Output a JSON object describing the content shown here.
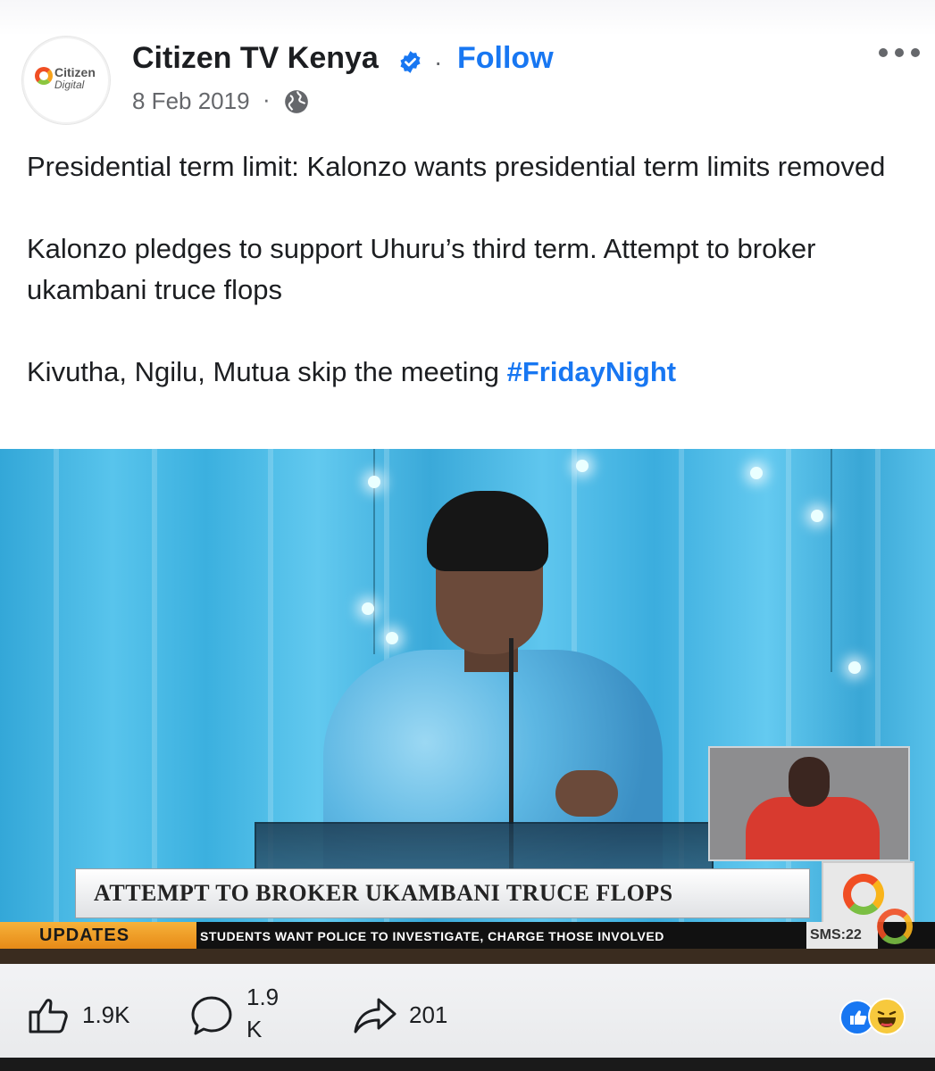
{
  "post": {
    "page_name": "Citizen TV Kenya",
    "follow_label": "Follow",
    "separator": "·",
    "date": "8 Feb 2019",
    "date_separator": "·",
    "avatar_text_line1": "Citizen",
    "avatar_text_line2": "Digital",
    "paragraph_1": "Presidential term limit: Kalonzo wants presidential term limits removed",
    "paragraph_2": "Kalonzo pledges to support Uhuru’s third term. Attempt to broker ukambani truce flops",
    "paragraph_3_text": "Kivutha, Ngilu, Mutua skip the meeting ",
    "hashtag": "#FridayNight"
  },
  "media": {
    "headline": "ATTEMPT TO BROKER UKAMBANI TRUCE FLOPS",
    "ticker_label": "UPDATES",
    "ticker_text": "STUDENTS WANT POLICE TO INVESTIGATE, CHARGE THOSE INVOLVED",
    "ticker_sms": "SMS:22"
  },
  "actions": {
    "likes": "1.9K",
    "comments_line1": "1.9",
    "comments_line2": "K",
    "shares": "201"
  },
  "icons": {
    "verified": "verified-badge-icon",
    "globe": "globe-icon",
    "more": "more-options-icon",
    "like": "thumbs-up-icon",
    "comment": "comment-icon",
    "share": "share-icon"
  },
  "colors": {
    "link": "#1877f2",
    "text": "#1c1e21",
    "muted": "#65676b"
  }
}
